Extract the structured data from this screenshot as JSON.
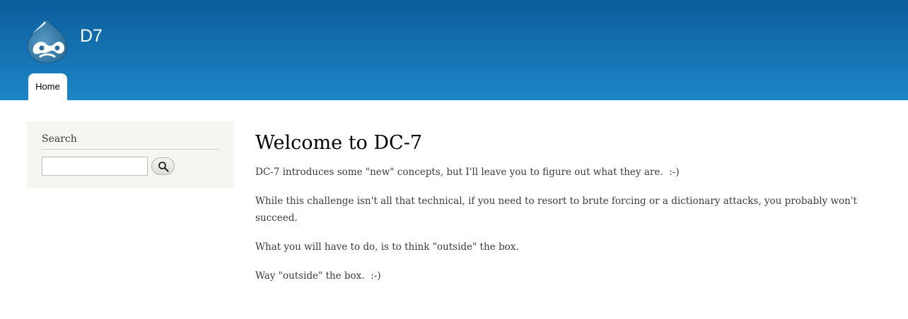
{
  "header": {
    "logo_icon": "drupal-drop-icon",
    "site_name": "D7",
    "gradient_colors": [
      "#0c5d9c",
      "#1d86c7"
    ]
  },
  "main_menu": {
    "items": [
      {
        "label": "Home",
        "active": true
      }
    ]
  },
  "sidebar": {
    "search_block": {
      "title": "Search",
      "input_value": "",
      "button_icon": "magnifier-icon"
    }
  },
  "content": {
    "title": "Welcome to DC-7",
    "paragraphs": [
      "DC-7 introduces some \"new\" concepts, but I'll leave you to figure out what they are.  :-)",
      "While this challenge isn't all that technical, if you need to resort to brute forcing or a dictionary attacks, you probably won't succeed.",
      "What you will have to do, is to think \"outside\" the box.",
      "Way \"outside\" the box.  :-)"
    ]
  }
}
